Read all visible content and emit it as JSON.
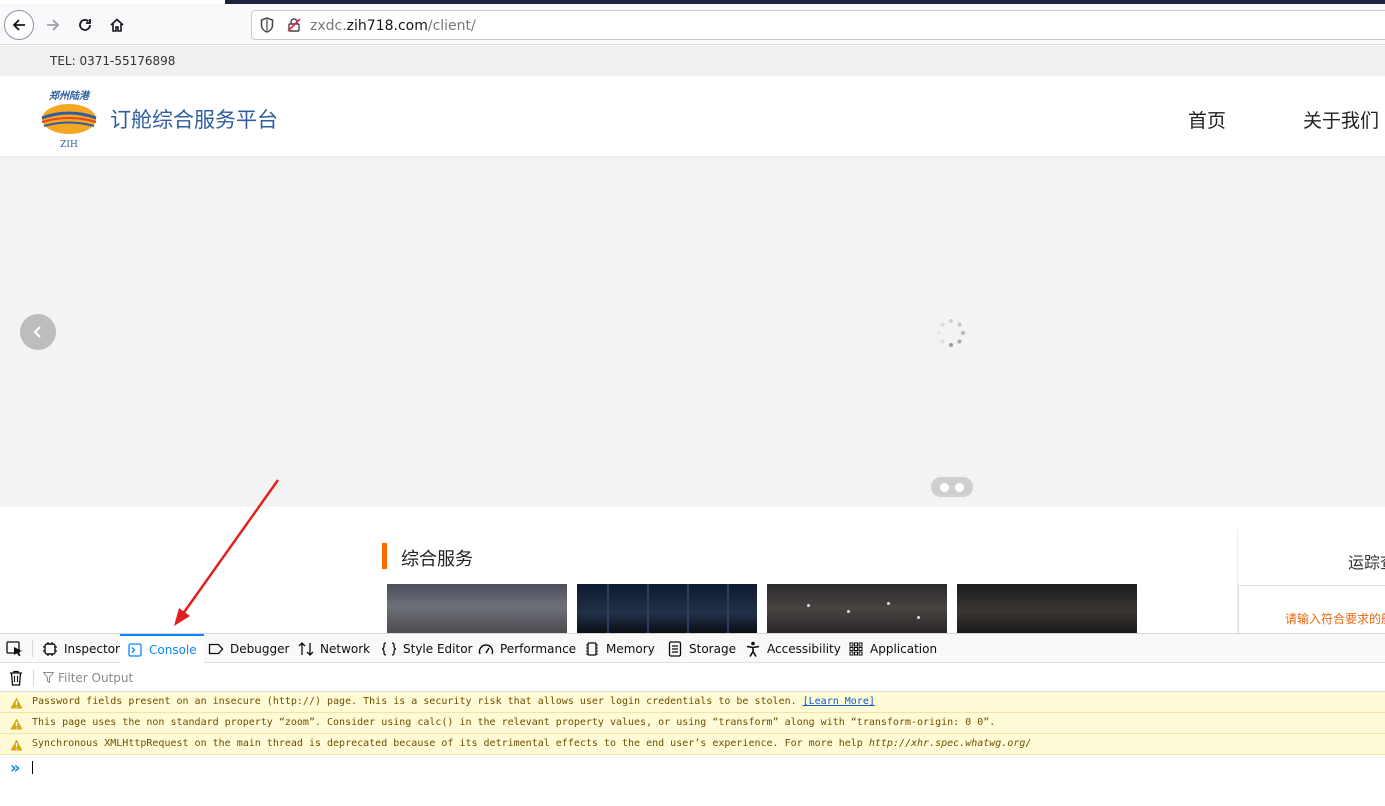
{
  "browser": {
    "url_host_prefix": "zxdc.",
    "url_host_domain": "zih718.com",
    "url_path": "/client/"
  },
  "page": {
    "tel": "TEL:  0371-55176898",
    "logo_top_text": "郑州陆港",
    "logo_bottom_text": "ZIH",
    "site_title": "订舱综合服务平台",
    "nav": {
      "home": "首页",
      "about": "关于我们"
    },
    "section_title": "综合服务",
    "side_tab": "运踪查",
    "side_hint": "请输入符合要求的航"
  },
  "devtools": {
    "tabs": [
      {
        "label": "Inspector",
        "icon": "inspector-icon"
      },
      {
        "label": "Console",
        "icon": "console-icon",
        "selected": true
      },
      {
        "label": "Debugger",
        "icon": "debugger-icon"
      },
      {
        "label": "Network",
        "icon": "network-icon"
      },
      {
        "label": "Style Editor",
        "icon": "style-editor-icon"
      },
      {
        "label": "Performance",
        "icon": "performance-icon"
      },
      {
        "label": "Memory",
        "icon": "memory-icon"
      },
      {
        "label": "Storage",
        "icon": "storage-icon"
      },
      {
        "label": "Accessibility",
        "icon": "accessibility-icon"
      },
      {
        "label": "Application",
        "icon": "application-icon"
      }
    ],
    "filter_placeholder": "Filter Output",
    "messages": [
      {
        "text": "Password fields present on an insecure (http://) page. This is a security risk that allows user login credentials to be stolen. ",
        "link": "[Learn More]"
      },
      {
        "text": "This page uses the non standard property “zoom”. Consider using calc() in the relevant property values, or using “transform” along with “transform-origin: 0 0”."
      },
      {
        "text": "Synchronous XMLHttpRequest on the main thread is deprecated because of its detrimental effects to the end user’s experience. For more help ",
        "url": "http://xhr.spec.whatwg.org/"
      }
    ],
    "prompt_symbol": "»"
  },
  "colors": {
    "accent": "#0a84ff",
    "section_marker": "#ff6a00",
    "title_blue": "#2f5fa0",
    "warning_bg": "#fffbd6"
  }
}
